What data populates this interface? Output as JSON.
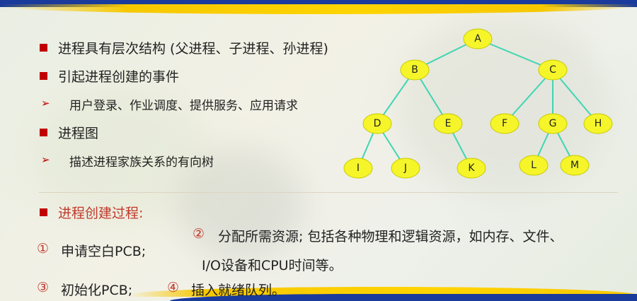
{
  "bullets": {
    "b1": "进程具有层次结构 (父进程、子进程、孙进程)",
    "b2": "引起进程创建的事件",
    "b2_sub": "用户登录、作业调度、提供服务、应用请求",
    "b3": "进程图",
    "b3_sub": "描述进程家族关系的有向树"
  },
  "process": {
    "heading": "进程创建过程:",
    "step1_num": "①",
    "step1": "申请空白PCB;",
    "step2_num": "②",
    "step2_line1": "分配所需资源; 包括各种物理和逻辑资源，如内存、文件、",
    "step2_line2": "I/O设备和CPU时间等。",
    "step3_num": "③",
    "step3": "初始化PCB;",
    "step4_num": "④",
    "step4": "插入就绪队列。"
  },
  "tree": {
    "nodes": [
      {
        "id": "A",
        "label": "A"
      },
      {
        "id": "B",
        "label": "B"
      },
      {
        "id": "C",
        "label": "C"
      },
      {
        "id": "D",
        "label": "D"
      },
      {
        "id": "E",
        "label": "E"
      },
      {
        "id": "F",
        "label": "F"
      },
      {
        "id": "G",
        "label": "G"
      },
      {
        "id": "H",
        "label": "H"
      },
      {
        "id": "I",
        "label": "I"
      },
      {
        "id": "J",
        "label": "J"
      },
      {
        "id": "K",
        "label": "K"
      },
      {
        "id": "L",
        "label": "L"
      },
      {
        "id": "M",
        "label": "M"
      }
    ],
    "edges": [
      [
        "A",
        "B"
      ],
      [
        "A",
        "C"
      ],
      [
        "B",
        "D"
      ],
      [
        "B",
        "E"
      ],
      [
        "C",
        "F"
      ],
      [
        "C",
        "G"
      ],
      [
        "C",
        "H"
      ],
      [
        "D",
        "I"
      ],
      [
        "D",
        "J"
      ],
      [
        "E",
        "K"
      ],
      [
        "G",
        "L"
      ],
      [
        "G",
        "M"
      ]
    ],
    "colors": {
      "node_fill": "#f5f52a",
      "edge": "#3fd6b3"
    }
  },
  "colors": {
    "bullet": "#c00000",
    "heading": "#c0392b"
  }
}
